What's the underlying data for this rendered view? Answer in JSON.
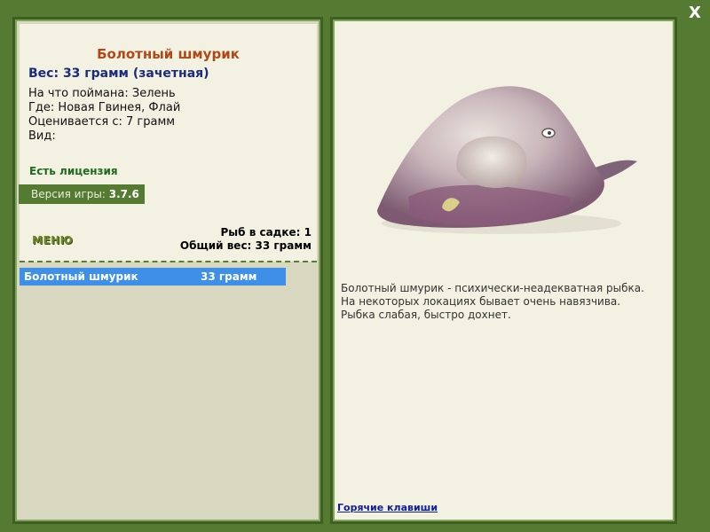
{
  "window": {
    "close_label": "X"
  },
  "fish": {
    "title": "Болотный шмурик",
    "weight_line": "Вес: 33 грамм (зачетная)",
    "caught_on": "На что поймана: Зелень",
    "location": "Где: Новая Гвинея, Флай",
    "rated_from": "Оценивается с: 7 грамм",
    "kind": "Вид:"
  },
  "license": "Есть лицензия",
  "version": {
    "label": "Версия игры: ",
    "value": "3.7.6"
  },
  "menu_label": "МЕНЮ",
  "cage": {
    "count": "Рыб в садке: 1",
    "total_weight": "Общий вес: 33 грамм"
  },
  "catch_list": [
    {
      "name": "Болотный шмурик",
      "weight": "33 грамм"
    }
  ],
  "description": {
    "line1": "Болотный шмурик - психически-неадекватная рыбка.",
    "line2": "На некоторых локациях бывает очень навязчива.",
    "line3": "Рыбка слабая, быстро дохнет."
  },
  "hotkeys_label": "Горячие клавиши",
  "colors": {
    "background": "#557a32",
    "title": "#b04818",
    "weight": "#1a2c7a",
    "license": "#1f6a1f",
    "selected_row": "#3d8fe8"
  }
}
